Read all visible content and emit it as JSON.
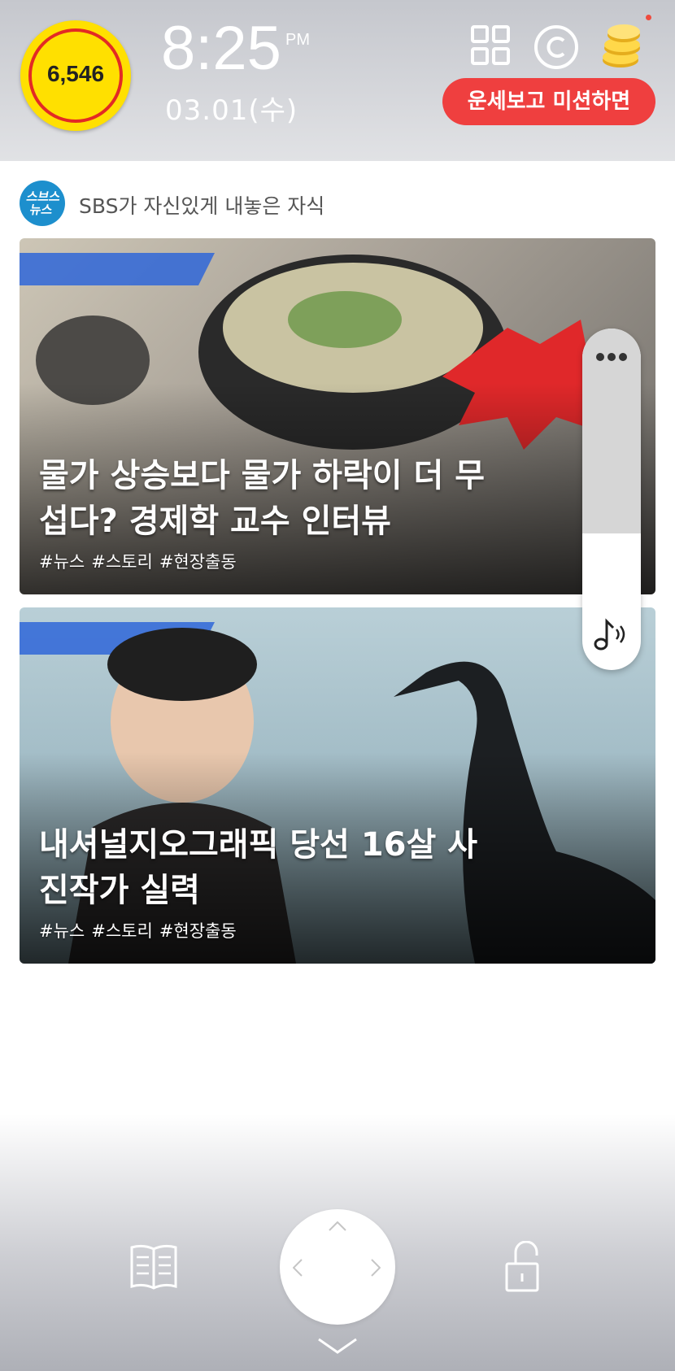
{
  "status": {
    "coin_count": "6,546",
    "time": "8:25",
    "ampm": "PM",
    "date": "03.01(수)"
  },
  "header": {
    "mission_button": "운세보고 미션하면",
    "icons": [
      "grid-icon",
      "copyright-icon",
      "coins-icon"
    ]
  },
  "source": {
    "logo_text": "스브스 뉴스",
    "title": "SBS가 자신있게 내놓은 자식"
  },
  "cards": [
    {
      "headline": "물가 상승보다 물가 하락이 더 무섭다? 경제학 교수 인터뷰",
      "tags": [
        "#뉴스",
        "#스토리",
        "#현장출동"
      ]
    },
    {
      "headline": "내셔널지오그래픽 당선 16살 사진작가 실력",
      "tags": [
        "#뉴스",
        "#스토리",
        "#현장출동"
      ]
    }
  ],
  "volume": {
    "level": 0.4,
    "icons": [
      "more-icon",
      "music-icon"
    ]
  },
  "bottom_nav": {
    "icons": [
      "book-icon",
      "unlock-icon",
      "chevron-up-icon",
      "chevron-left-icon",
      "chevron-right-icon",
      "chevron-down-icon"
    ]
  },
  "colors": {
    "accent_red": "#ef3f3f",
    "coin_yellow": "#ffe000",
    "logo_blue": "#1d8fcd"
  }
}
